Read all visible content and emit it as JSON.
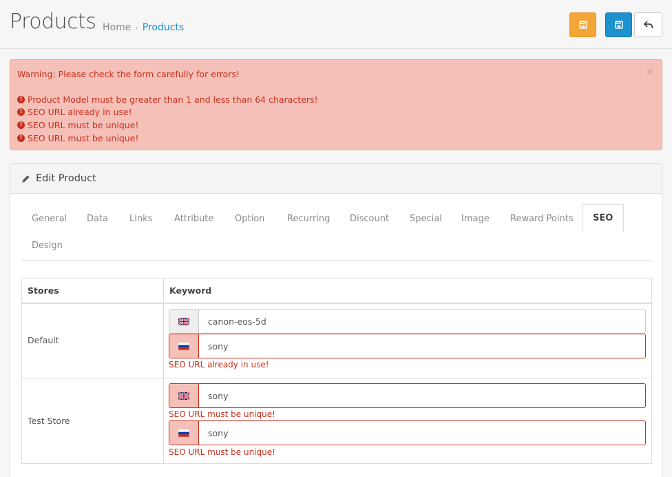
{
  "header": {
    "title": "Products",
    "breadcrumb": [
      {
        "label": "Home"
      },
      {
        "label": "Products"
      }
    ],
    "separator": "›"
  },
  "alert": {
    "title": "Warning: Please check the form carefully for errors!",
    "errors": [
      "Product Model must be greater than 1 and less than 64 characters!",
      "SEO URL already in use!",
      "SEO URL must be unique!",
      "SEO URL must be unique!"
    ],
    "close": "×"
  },
  "panel": {
    "title": "Edit Product",
    "tabs": [
      {
        "label": "General"
      },
      {
        "label": "Data"
      },
      {
        "label": "Links"
      },
      {
        "label": "Attribute"
      },
      {
        "label": "Option"
      },
      {
        "label": "Recurring"
      },
      {
        "label": "Discount"
      },
      {
        "label": "Special"
      },
      {
        "label": "Image"
      },
      {
        "label": "Reward Points"
      },
      {
        "label": "SEO"
      },
      {
        "label": "Design"
      }
    ],
    "active_tab": "SEO"
  },
  "seo": {
    "headers": {
      "stores": "Stores",
      "keyword": "Keyword"
    },
    "rows": [
      {
        "store": "Default",
        "fields": [
          {
            "lang_icon": "uk-flag-icon",
            "value": "canon-eos-5d",
            "error": ""
          },
          {
            "lang_icon": "ru-flag-icon",
            "value": "sony",
            "error": "SEO URL already in use!"
          }
        ]
      },
      {
        "store": "Test Store",
        "fields": [
          {
            "lang_icon": "uk-flag-icon",
            "value": "sony",
            "error": "SEO URL must be unique!"
          },
          {
            "lang_icon": "ru-flag-icon",
            "value": "sony",
            "error": "SEO URL must be unique!"
          }
        ]
      }
    ]
  },
  "colors": {
    "primary": "#1e91cf",
    "warning": "#f3a638",
    "danger": "#c72f1d",
    "alert_bg": "#f5c0b8"
  }
}
